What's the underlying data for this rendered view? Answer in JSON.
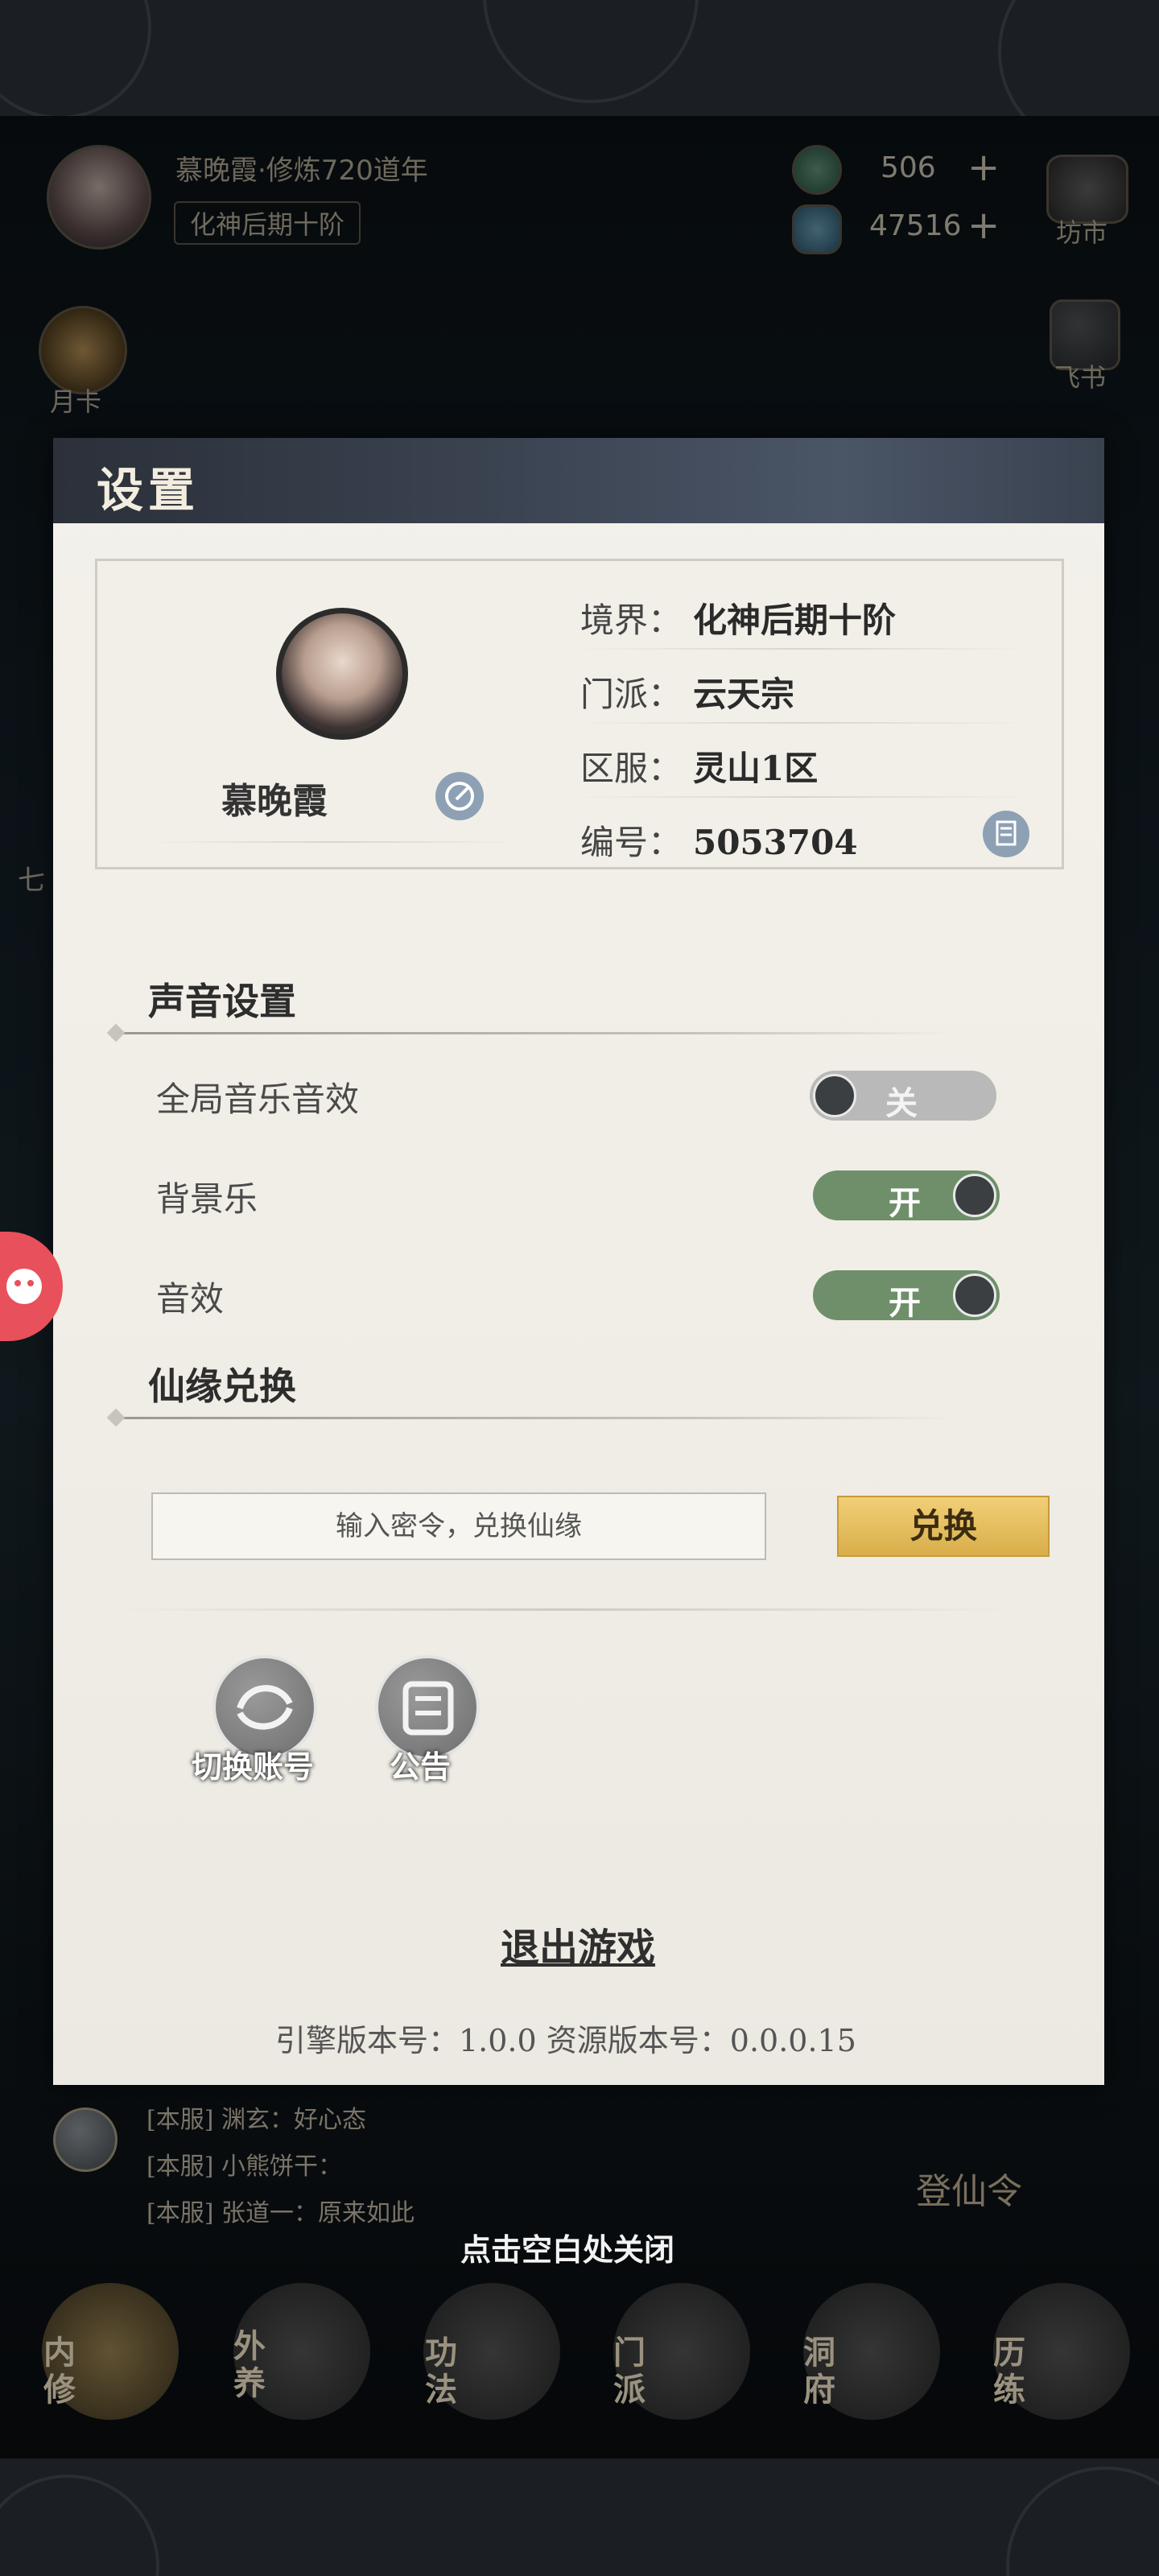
{
  "hud": {
    "player_name": "慕晚霞·修炼720道年",
    "realm_badge": "化神后期十阶",
    "currency1": "506",
    "currency2": "47516",
    "plus": "+",
    "market_label": "坊市",
    "monthly_card_label": "月卡",
    "flying_book_label": "飞书",
    "side_label": "七"
  },
  "modal": {
    "title": "设置",
    "profile": {
      "name": "慕晚霞",
      "realm_label": "境界：",
      "realm_value": "化神后期十阶",
      "sect_label": "门派：",
      "sect_value": "云天宗",
      "server_label": "区服：",
      "server_value": "灵山1区",
      "id_label": "编号：",
      "id_value": "5053704"
    },
    "sound": {
      "section_title": "声音设置",
      "global_label": "全局音乐音效",
      "global_state": "关",
      "bgm_label": "背景乐",
      "bgm_state": "开",
      "sfx_label": "音效",
      "sfx_state": "开"
    },
    "redeem": {
      "section_title": "仙缘兑换",
      "placeholder": "输入密令，兑换仙缘",
      "button": "兑换"
    },
    "switch_account": "切换账号",
    "announcement": "公告",
    "exit_game": "退出游戏",
    "version": "引擎版本号：1.0.0 资源版本号：0.0.0.15"
  },
  "chat": {
    "line1": "[本服] 渊玄：好心态",
    "line2": "[本服] 小熊饼干：",
    "line3": "[本服] 张道一：原来如此"
  },
  "token_label": "登仙令",
  "close_hint": "点击空白处关闭",
  "bottom_nav": [
    "内修",
    "外养",
    "功法",
    "门派",
    "洞府",
    "历练"
  ],
  "colors": {
    "toggle_on": "#6e8f6a",
    "toggle_off": "#b9b9b9",
    "redeem_button": "#e4bd5f",
    "modal_bg": "#f0eee7",
    "header_bg": "#3a4250"
  }
}
